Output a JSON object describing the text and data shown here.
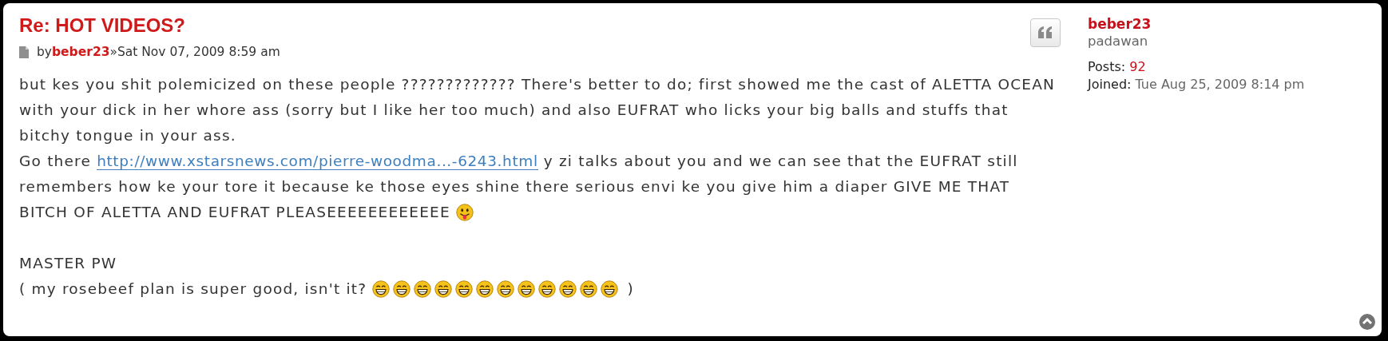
{
  "post": {
    "title": "Re: HOT VIDEOS?",
    "meta": {
      "by": "by",
      "author": "beber23",
      "separator": "»",
      "date": "Sat Nov 07, 2009 8:59 am"
    },
    "body": [
      {
        "segments": [
          {
            "kind": "text",
            "text": "but kes you shit polemicized on these people ????????????? There's better to do; first showed me the cast of ALETTA OCEAN with your dick in her whore ass (sorry but I like her too much) and also EUFRAT who licks your big balls and stuffs that bitchy tongue in your ass."
          }
        ]
      },
      {
        "segments": [
          {
            "kind": "text",
            "text": "Go there "
          },
          {
            "kind": "link",
            "text": "http://www.xstarsnews.com/pierre-woodma...-6243.html"
          },
          {
            "kind": "text",
            "text": " y zi talks about you and we can see that the EUFRAT still remembers how ke your tore it because ke those eyes shine there serious envi ke you give him a diaper GIVE ME THAT BITCH OF ALETTA AND EUFRAT PLEASEEEEEEEEEEEE "
          },
          {
            "kind": "tongue_emoji"
          }
        ]
      }
    ],
    "signature": [
      {
        "segments": [
          {
            "kind": "text",
            "text": "MASTER PW"
          }
        ]
      },
      {
        "segments": [
          {
            "kind": "text",
            "text": "( my rosebeef plan is super good, isn't it? "
          },
          {
            "kind": "grin_emoji"
          },
          {
            "kind": "grin_emoji"
          },
          {
            "kind": "grin_emoji"
          },
          {
            "kind": "grin_emoji"
          },
          {
            "kind": "grin_emoji"
          },
          {
            "kind": "grin_emoji"
          },
          {
            "kind": "grin_emoji"
          },
          {
            "kind": "grin_emoji"
          },
          {
            "kind": "grin_emoji"
          },
          {
            "kind": "grin_emoji"
          },
          {
            "kind": "grin_emoji"
          },
          {
            "kind": "grin_emoji"
          },
          {
            "kind": "text",
            "text": " )"
          }
        ]
      }
    ]
  },
  "profile": {
    "username": "beber23",
    "rank": "padawan",
    "stats": [
      {
        "label": "Posts:",
        "value": "92",
        "kind": "link"
      },
      {
        "label": "Joined:",
        "value": "Tue Aug 25, 2009 8:14 pm",
        "kind": "plain"
      }
    ]
  }
}
